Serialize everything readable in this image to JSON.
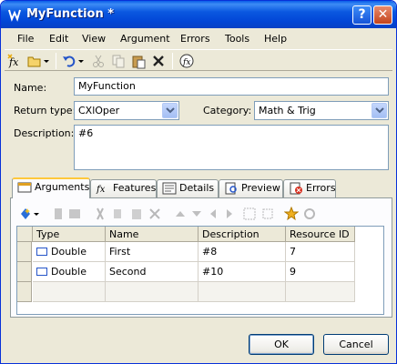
{
  "window": {
    "title": "MyFunction *"
  },
  "menu": [
    "File",
    "Edit",
    "View",
    "Argument",
    "Errors",
    "Tools",
    "Help"
  ],
  "form": {
    "name_label": "Name:",
    "name_value": "MyFunction",
    "return_type_label": "Return type:",
    "return_type_value": "CXlOper",
    "category_label": "Category:",
    "category_value": "Math & Trig",
    "description_label": "Description:",
    "description_value": "#6"
  },
  "tabs": [
    "Arguments",
    "Features",
    "Details",
    "Preview",
    "Errors"
  ],
  "grid": {
    "columns": [
      "Type",
      "Name",
      "Description",
      "Resource ID"
    ],
    "rows": [
      {
        "type": "Double",
        "name": "First",
        "description": "#8",
        "resource_id": "7"
      },
      {
        "type": "Double",
        "name": "Second",
        "description": "#10",
        "resource_id": "9"
      }
    ]
  },
  "buttons": {
    "ok": "OK",
    "cancel": "Cancel"
  },
  "colors": {
    "titlebar": "#0a58e0",
    "accent_tab": "#ffc83c",
    "face": "#ece9d8"
  }
}
